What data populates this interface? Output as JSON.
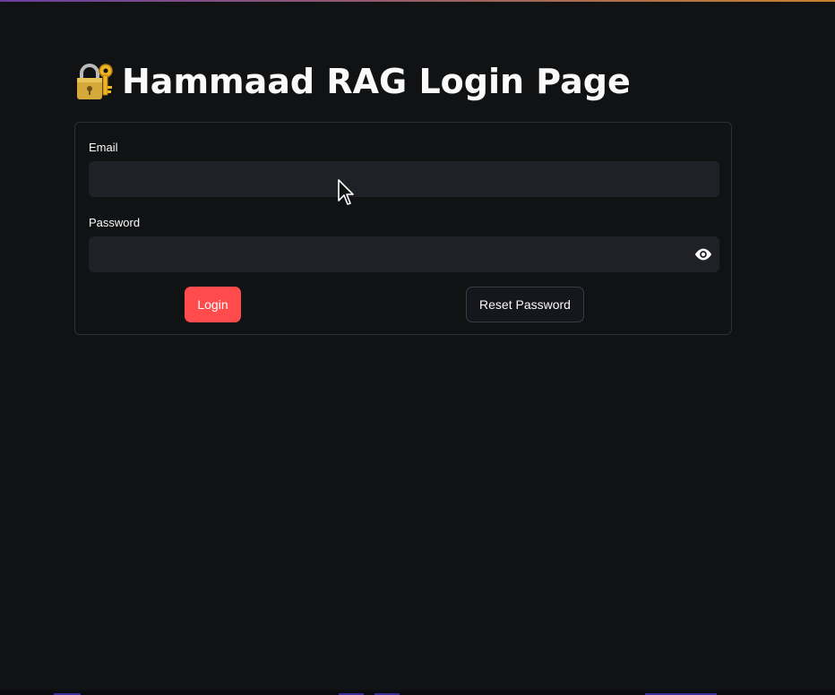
{
  "page": {
    "title": "Hammaad RAG Login Page",
    "title_icon": "lock-with-key-icon"
  },
  "form": {
    "email": {
      "label": "Email",
      "value": "",
      "placeholder": ""
    },
    "password": {
      "label": "Password",
      "value": "",
      "placeholder": "",
      "toggle_icon": "eye-icon"
    },
    "buttons": {
      "login_label": "Login",
      "reset_label": "Reset Password"
    }
  },
  "colors": {
    "background": "#111214",
    "primary_button": "#ff4b4b",
    "input_background": "#1f2127",
    "border": "#2d2f36"
  }
}
